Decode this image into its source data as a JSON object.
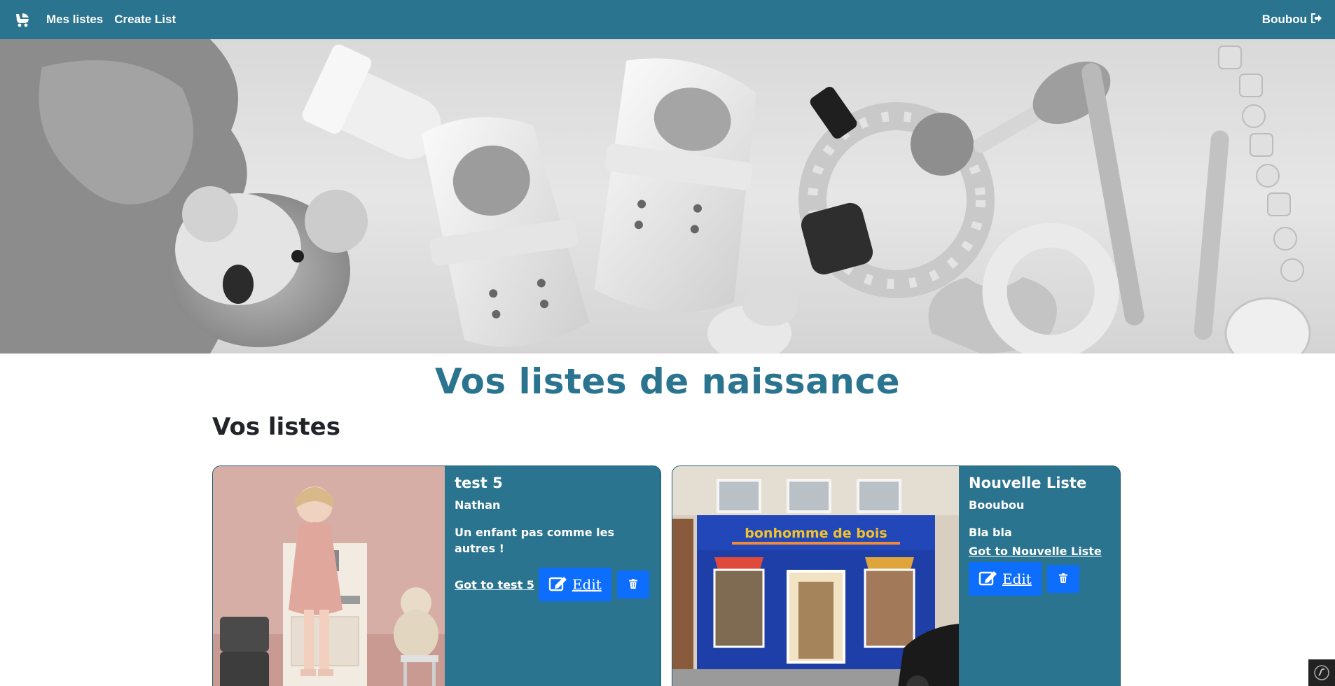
{
  "navbar": {
    "brand_icon": "baby-carriage-icon",
    "links": [
      "Mes listes",
      "Create List"
    ],
    "user": {
      "name": "Boubou",
      "icon": "sign-out-icon"
    }
  },
  "hero": {
    "description_icon": "baby-items-photo"
  },
  "page": {
    "title": "Vos listes de naissance",
    "section_title": "Vos listes"
  },
  "cards": [
    {
      "title": "test 5",
      "owner": "Nathan",
      "description": "Un enfant pas comme les autres !",
      "goto_label": "Got to test 5",
      "edit_label": "Edit"
    },
    {
      "title": "Nouvelle Liste",
      "owner": "Booubou",
      "description": "Bla bla",
      "goto_label": "Got to Nouvelle Liste",
      "edit_label": "Edit",
      "shop_sign": "bonhomme de bois"
    }
  ],
  "colors": {
    "primary": "#2a748f",
    "button": "#0d6efd"
  }
}
